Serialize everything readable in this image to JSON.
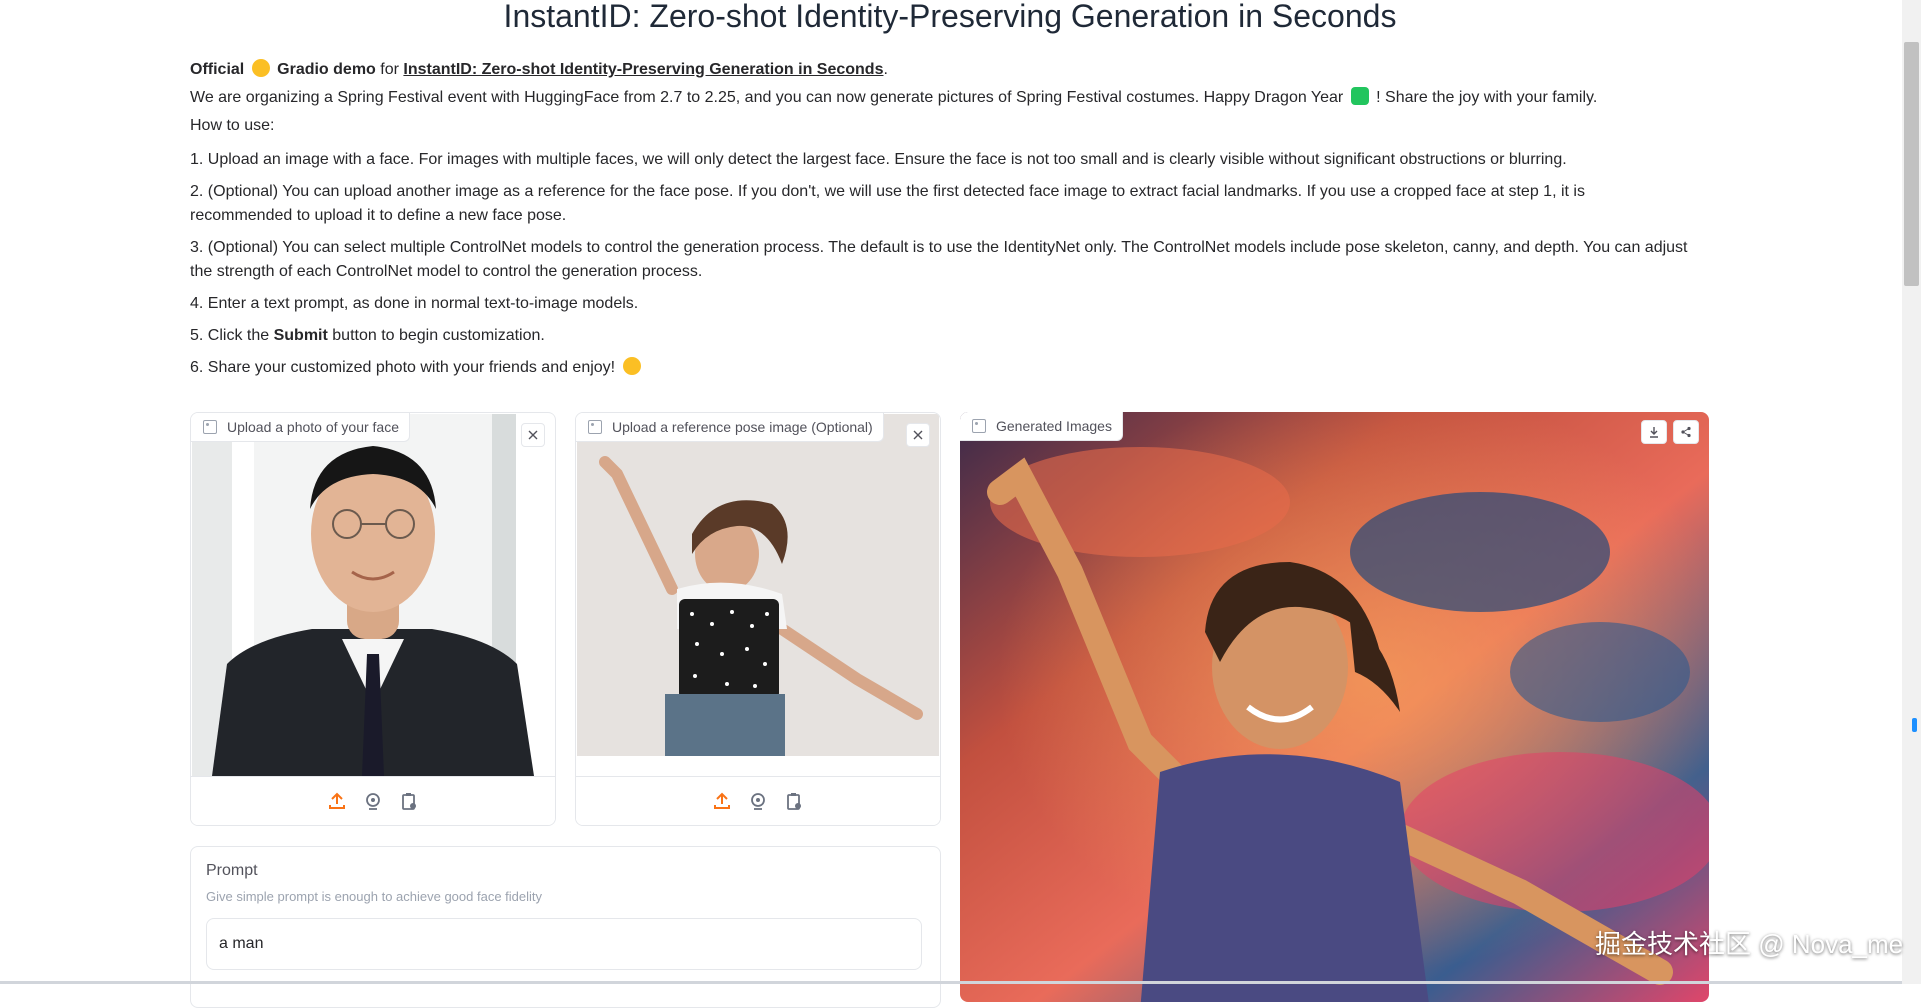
{
  "page": {
    "title": "InstantID: Zero-shot Identity-Preserving Generation in Seconds"
  },
  "intro": {
    "official": "Official",
    "gradio_demo": "Gradio demo",
    "for_text": "for",
    "paper_link": "InstantID: Zero-shot Identity-Preserving Generation in Seconds",
    "period": ".",
    "festival_text": "We are organizing a Spring Festival event with HuggingFace from 2.7 to 2.25, and you can now generate pictures of Spring Festival costumes. Happy Dragon Year",
    "festival_tail": "! Share the joy with your family.",
    "how_to_use": "How to use:",
    "steps": [
      "1. Upload an image with a face. For images with multiple faces, we will only detect the largest face. Ensure the face is not too small and is clearly visible without significant obstructions or blurring.",
      "2. (Optional) You can upload another image as a reference for the face pose. If you don't, we will use the first detected face image to extract facial landmarks. If you use a cropped face at step 1, it is recommended to upload it to define a new face pose.",
      "3. (Optional) You can select multiple ControlNet models to control the generation process. The default is to use the IdentityNet only. The ControlNet models include pose skeleton, canny, and depth. You can adjust the strength of each ControlNet model to control the generation process.",
      "4. Enter a text prompt, as done in normal text-to-image models."
    ],
    "step5_prefix": "5. Click the",
    "step5_bold": "Submit",
    "step5_suffix": "button to begin customization.",
    "step6": "6. Share your customized photo with your friends and enjoy!"
  },
  "face_upload": {
    "label": "Upload a photo of your face",
    "icon": "image-icon"
  },
  "pose_upload": {
    "label": "Upload a reference pose image (Optional)",
    "icon": "image-icon"
  },
  "output": {
    "label": "Generated Images",
    "icon": "image-icon"
  },
  "prompt": {
    "label": "Prompt",
    "info": "Give simple prompt is enough to achieve good face fidelity",
    "value": "a man"
  },
  "watermark": "掘金技术社区 @ Nova_me",
  "colors": {
    "accent": "#f97316",
    "text": "#27272a",
    "border": "#e5e7eb"
  }
}
